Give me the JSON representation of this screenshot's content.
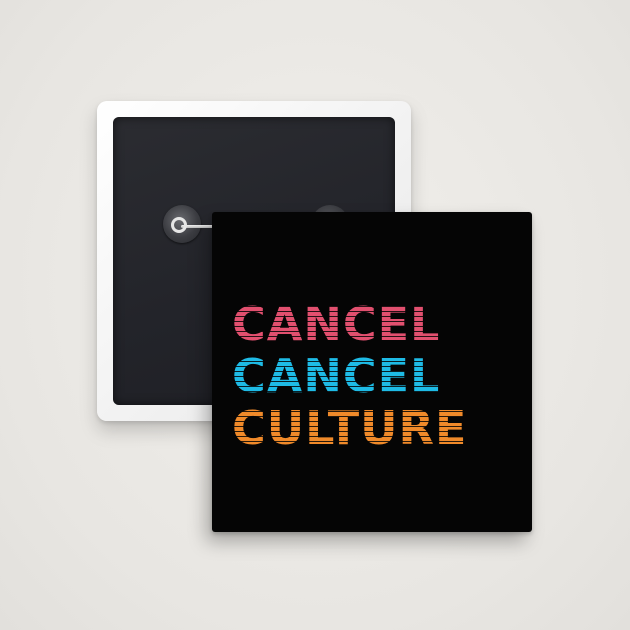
{
  "product": {
    "slogan_lines": [
      {
        "text": "CANCEL",
        "color": "#e2506f"
      },
      {
        "text": "CANCEL",
        "color": "#1ebbe6"
      },
      {
        "text": "CULTURE",
        "color": "#f08a2a"
      }
    ],
    "front_color": "#050505",
    "back_frame_color": "#ffffff",
    "back_inner_color": "#26272c",
    "background_color": "#ebe9e5"
  }
}
